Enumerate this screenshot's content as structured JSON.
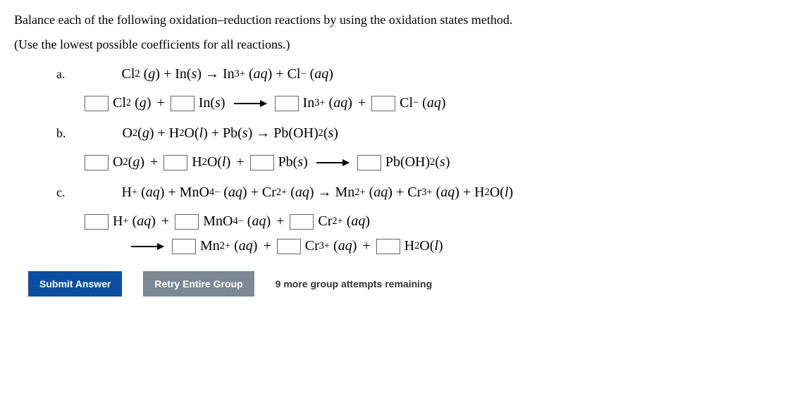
{
  "instruction": "Balance each of the following oxidation–reduction reactions by using the oxidation states method.",
  "hint": "(Use the lowest possible coefficients for all reactions.)",
  "parts": {
    "a": {
      "label": "a."
    },
    "b": {
      "label": "b."
    },
    "c": {
      "label": "c."
    }
  },
  "buttons": {
    "submit": "Submit Answer",
    "retry": "Retry Entire Group"
  },
  "attempts_text": "9 more group attempts remaining"
}
